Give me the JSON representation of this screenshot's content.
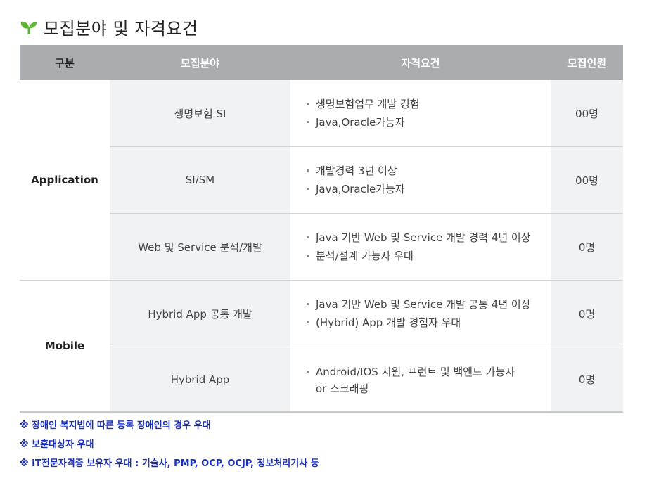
{
  "section": {
    "title": "모집분야 및 자격요건",
    "icon": "leaf-icon"
  },
  "table": {
    "headers": {
      "category": "구분",
      "field": "모집분야",
      "requirements": "자격요건",
      "count": "모집인원"
    },
    "groups": [
      {
        "category": "Application",
        "rows": [
          {
            "field": "생명보험 SI",
            "requirements": [
              "생명보험업무 개발 경험",
              "Java,Oracle가능자"
            ],
            "count": "00명"
          },
          {
            "field": "SI/SM",
            "requirements": [
              "개발경력 3년 이상",
              "Java,Oracle가능자"
            ],
            "count": "00명"
          },
          {
            "field": "Web 및 Service 분석/개발",
            "requirements": [
              "Java 기반 Web 및 Service 개발 경력 4년 이상",
              "분석/설계 가능자 우대"
            ],
            "count": "0명"
          }
        ]
      },
      {
        "category": "Mobile",
        "rows": [
          {
            "field": "Hybrid App 공통 개발",
            "requirements": [
              "Java 기반 Web 및 Service 개발 공통 4년 이상",
              "(Hybrid) App 개발 경험자 우대"
            ],
            "count": "0명"
          },
          {
            "field": "Hybrid App",
            "requirements": [
              "Android/IOS 지원, 프런트 및 백엔드 가능자",
              "or 스크래핑"
            ],
            "count": "0명"
          }
        ]
      }
    ]
  },
  "notes": [
    "※ 장애인 복지법에 따른 등록 장애인의 경우 우대",
    "※ 보훈대상자 우대",
    "※ IT전문자격증 보유자 우대 : 기술사, PMP, OCP, OCJP, 정보처리기사 등"
  ],
  "colors": {
    "header_bg": "#a9adb0",
    "shaded_bg": "#f1f2f3",
    "note_text": "#1a2fb8",
    "leaf": "#5bb531"
  }
}
